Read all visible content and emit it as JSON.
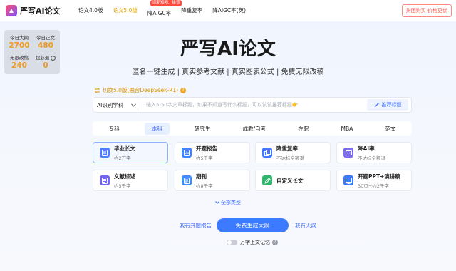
{
  "brand": {
    "name": "严写AI论文"
  },
  "nav": {
    "items": [
      {
        "label": "论文4.0版"
      },
      {
        "label": "论文5.0版"
      },
      {
        "label": "降AIGC率",
        "badge": "适配知网、维普"
      },
      {
        "label": "降重复率"
      },
      {
        "label": "降AIGC率(英)"
      }
    ],
    "buy_label": "拼团购买 价格更优"
  },
  "stats": {
    "items": [
      {
        "label": "今日大纲",
        "value": "2700"
      },
      {
        "label": "今日正文",
        "value": "480"
      },
      {
        "label": "无限改稿",
        "value": "240"
      },
      {
        "label": "超必退",
        "value": "0"
      }
    ]
  },
  "hero": {
    "title": "严写AI论文",
    "subtitle": "匿名一键生成 | 真实参考文献 | 真实图表公式 | 免费无限改稿"
  },
  "switch": {
    "label": "切换5.0版(融合DeepSeek-R1)"
  },
  "input": {
    "type_label": "AI识别学科",
    "placeholder": "输入5-50字文章标题，如果不知道写什么标题，可以试试推荐标题👉",
    "suggest_label": "推荐标题"
  },
  "levels": [
    "专科",
    "本科",
    "研究生",
    "成教/自考",
    "在职",
    "MBA",
    "范文"
  ],
  "cards": [
    {
      "title": "毕业长文",
      "sub": "约2万字",
      "color": "#4f7dff"
    },
    {
      "title": "开题报告",
      "sub": "约5千字",
      "color": "#3d86ff"
    },
    {
      "title": "降重复率",
      "sub": "不达标全额退",
      "color": "#4476ff"
    },
    {
      "title": "降AI率",
      "sub": "不达标全额退",
      "color": "#7c6cf0"
    },
    {
      "title": "文献综述",
      "sub": "约5千字",
      "color": "#7265ef"
    },
    {
      "title": "期刊",
      "sub": "约8千字",
      "color": "#3f8cff"
    },
    {
      "title": "自定义长文",
      "sub": "",
      "color": "#31b56e"
    },
    {
      "title": "开题PPT+演讲稿",
      "sub": "30页+约2千字",
      "color": "#3a7cf5"
    }
  ],
  "all_types_label": "全部类型",
  "actions": {
    "left_link": "我有开题报告",
    "primary": "免费生成大纲",
    "right_link": "我有大纲"
  },
  "memory": {
    "label": "万字上文记忆"
  },
  "colors": {
    "accent": "#3c7bff",
    "highlight": "#f09a1e",
    "brand_start": "#ff4f6d",
    "brand_end": "#7b4dff"
  }
}
